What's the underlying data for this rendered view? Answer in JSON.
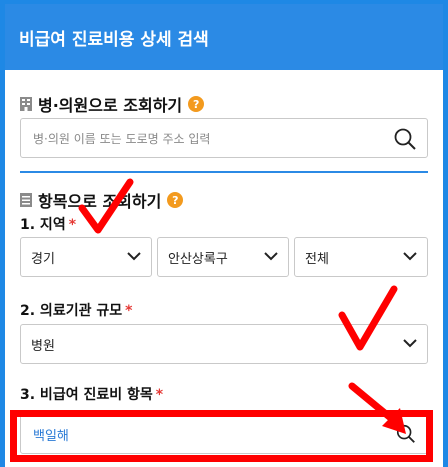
{
  "header": {
    "title": "비급여 진료비용 상세 검색"
  },
  "hospital_search": {
    "title": "병·의원으로 조회하기",
    "help": "?",
    "placeholder": "병·의원 이름 또는 도로명 주소 입력"
  },
  "item_search": {
    "title": "항목으로 조회하기",
    "help": "?"
  },
  "region": {
    "label": "1. 지역",
    "required": "*",
    "province": "경기",
    "city": "안산상록구",
    "district": "전체"
  },
  "scale": {
    "label": "2. 의료기관 규모",
    "required": "*",
    "value": "병원"
  },
  "treatment": {
    "label": "3. 비급여 진료비 항목",
    "required": "*",
    "value": "백일해"
  },
  "colors": {
    "header_bg": "#2b8ae5",
    "help_badge": "#f39a1e",
    "required_star": "#e53935",
    "annotation_red": "#ff0000"
  }
}
